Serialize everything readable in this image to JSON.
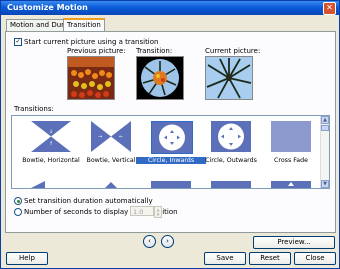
{
  "window": {
    "title": "Customize Motion"
  },
  "tabs": [
    {
      "label": "Motion and Duration"
    },
    {
      "label": "Transition"
    }
  ],
  "transition_tab": {
    "start_checkbox_label": "Start current picture using a transition",
    "start_checked": true,
    "previous_picture_label": "Previous picture:",
    "transition_label": "Transition:",
    "current_picture_label": "Current picture:",
    "transitions_label": "Transitions:",
    "transitions": [
      {
        "name": "Bowtie, Horizontal"
      },
      {
        "name": "Bowtie, Vertical"
      },
      {
        "name": "Circle, Inwards",
        "selected": true
      },
      {
        "name": "Circle, Outwards"
      },
      {
        "name": "Cross Fade"
      }
    ],
    "duration_auto_label": "Set transition duration automatically",
    "duration_manual_label": "Number of seconds to display the transition",
    "duration_value": "1.0",
    "selected_duration_option": "auto"
  },
  "buttons": {
    "preview": "Preview...",
    "help": "Help",
    "save": "Save",
    "reset": "Reset",
    "close": "Close"
  },
  "colors": {
    "titlebar": "#0a5bd8",
    "selection": "#316ac5",
    "tile": "#5b70b8"
  }
}
